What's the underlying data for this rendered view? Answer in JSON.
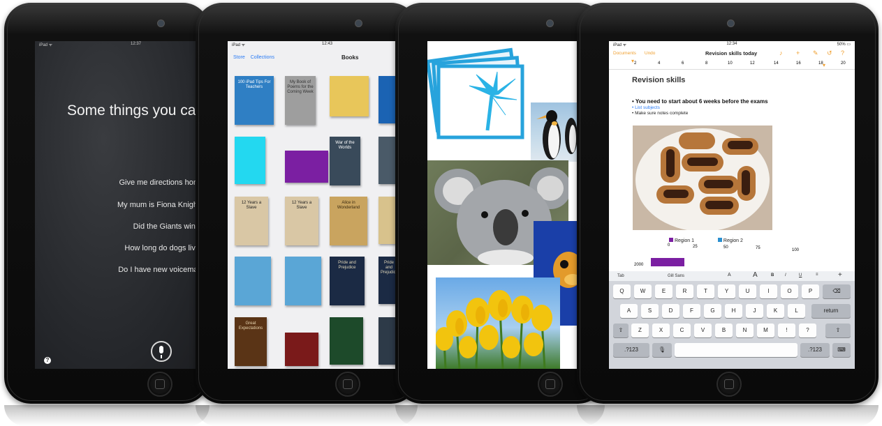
{
  "ipad1": {
    "status_left": "iPad ᯤ",
    "status_time": "12:37",
    "title": "Some things you can",
    "suggestions": [
      "Give me directions hom",
      "My mum is Fiona Knight",
      "Did the Giants win?",
      "How long do dogs live",
      "Do I have new voicemai"
    ]
  },
  "ipad2": {
    "status_left": "iPad ᯤ",
    "status_time": "12:43",
    "nav_store": "Store",
    "nav_collections": "Collections",
    "nav_title": "Books",
    "books": [
      {
        "title": "100 iPad Tips For Teachers",
        "bg": "#2f7fc4",
        "fg": "#ffffff"
      },
      {
        "title": "My Book of Poems for the Coming Week",
        "bg": "#9e9e9e",
        "fg": "#333333"
      },
      {
        "title": "",
        "bg": "#e8c65a",
        "fg": "#333333"
      },
      {
        "title": "",
        "bg": "#1b63b3",
        "fg": "#ffffff"
      },
      {
        "title": "",
        "bg": "#23d8f0",
        "fg": "#111111"
      },
      {
        "title": "",
        "bg": "#7b1fa2",
        "fg": "#ffffff"
      },
      {
        "title": "War of the Worlds",
        "bg": "#394a5a",
        "fg": "#ffffff"
      },
      {
        "title": "",
        "bg": "#4a5a68",
        "fg": "#ffffff"
      },
      {
        "title": "12 Years a Slave",
        "bg": "#d9c7a5",
        "fg": "#222222"
      },
      {
        "title": "12 Years a Slave",
        "bg": "#d9c7a5",
        "fg": "#222222"
      },
      {
        "title": "Alice in Wonderland",
        "bg": "#c9a45f",
        "fg": "#3a2a10"
      },
      {
        "title": "",
        "bg": "#d8c28c",
        "fg": "#3a2a10"
      },
      {
        "title": "",
        "bg": "#5aa6d6",
        "fg": "#ffffff"
      },
      {
        "title": "",
        "bg": "#5aa6d6",
        "fg": "#ffffff"
      },
      {
        "title": "Pride and Prejudice",
        "bg": "#1b2a44",
        "fg": "#e0d6b8"
      },
      {
        "title": "Pride and Prejudice",
        "bg": "#1b2a44",
        "fg": "#e0d6b8"
      },
      {
        "title": "Great Expectations",
        "bg": "#5a3416",
        "fg": "#e9d6b0"
      },
      {
        "title": "",
        "bg": "#7a1a1a",
        "fg": "#ffffff"
      },
      {
        "title": "",
        "bg": "#1d4a2a",
        "fg": "#e0d6b8"
      },
      {
        "title": "",
        "bg": "#2d3a48",
        "fg": "#ffffff"
      }
    ]
  },
  "ipad3": {
    "photos": [
      "palm-tree-icon",
      "penguin",
      "koala",
      "goldfish",
      "tulips"
    ]
  },
  "ipad4": {
    "status_left": "iPad ᯤ",
    "status_time": "12:34",
    "status_right": "50% ▭",
    "nav_documents": "Documents",
    "nav_undo": "Undo",
    "doc_title": "Revision skills today",
    "ruler": [
      "2",
      "4",
      "6",
      "8",
      "10",
      "12",
      "14",
      "16",
      "18",
      "20"
    ],
    "heading": "Revision skills",
    "bullet1": "• You need to start about 6 weeks before the exams",
    "bullet2": "• List subjects",
    "bullet3": "• Make sure notes complete",
    "legend1": "Region 1",
    "legend2": "Region 2",
    "axis": [
      "0",
      "25",
      "50",
      "75",
      "100"
    ],
    "axis_label": "2000",
    "toolbar_tab": "Tab",
    "toolbar_font": "Gill Sans",
    "toolbar_items": [
      "A",
      "A",
      "B",
      "I",
      "U",
      "≡",
      "+"
    ],
    "keys_row1": [
      "Q",
      "W",
      "E",
      "R",
      "T",
      "Y",
      "U",
      "I",
      "O",
      "P"
    ],
    "keys_row2": [
      "A",
      "S",
      "D",
      "F",
      "G",
      "H",
      "J",
      "K",
      "L"
    ],
    "keys_row3": [
      "Z",
      "X",
      "C",
      "V",
      "B",
      "N",
      "M",
      "!",
      "?"
    ],
    "key_return": "return",
    "key_num": ".?123"
  },
  "colors": {
    "ios_blue": "#2a7bf4",
    "pages_orange": "#f0a030",
    "bezel": "#111111"
  }
}
